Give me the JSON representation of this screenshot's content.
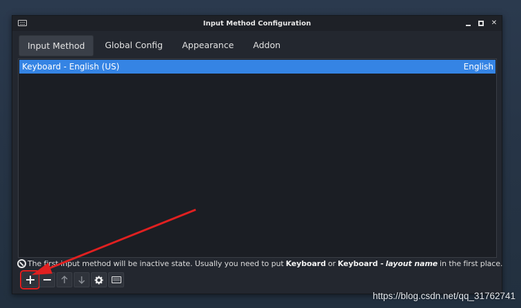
{
  "window": {
    "title": "Input Method Configuration"
  },
  "tabs": [
    {
      "label": "Input Method",
      "active": true
    },
    {
      "label": "Global Config",
      "active": false
    },
    {
      "label": "Appearance",
      "active": false
    },
    {
      "label": "Addon",
      "active": false
    }
  ],
  "list": {
    "items": [
      {
        "name": "Keyboard - English (US)",
        "language": "English",
        "selected": true
      }
    ]
  },
  "hint": {
    "prefix": "The first input method will be inactive state. Usually you need to put",
    "bold1": "Keyboard",
    "or": "or",
    "bold2": "Keyboard -",
    "italic": "layout name",
    "suffix": "in the first place."
  },
  "toolbar": {
    "buttons": [
      {
        "name": "add",
        "icon": "plus-icon"
      },
      {
        "name": "remove",
        "icon": "minus-icon"
      },
      {
        "name": "move-up",
        "icon": "arrow-up-icon"
      },
      {
        "name": "move-down",
        "icon": "arrow-down-icon"
      },
      {
        "name": "configure",
        "icon": "gear-icon"
      },
      {
        "name": "keyboard-layout",
        "icon": "keyboard-icon"
      }
    ]
  },
  "watermark": "https://blog.csdn.net/qq_31762741",
  "colors": {
    "selection": "#3584e4",
    "annotation": "#e02020",
    "window_bg": "#23272f"
  }
}
